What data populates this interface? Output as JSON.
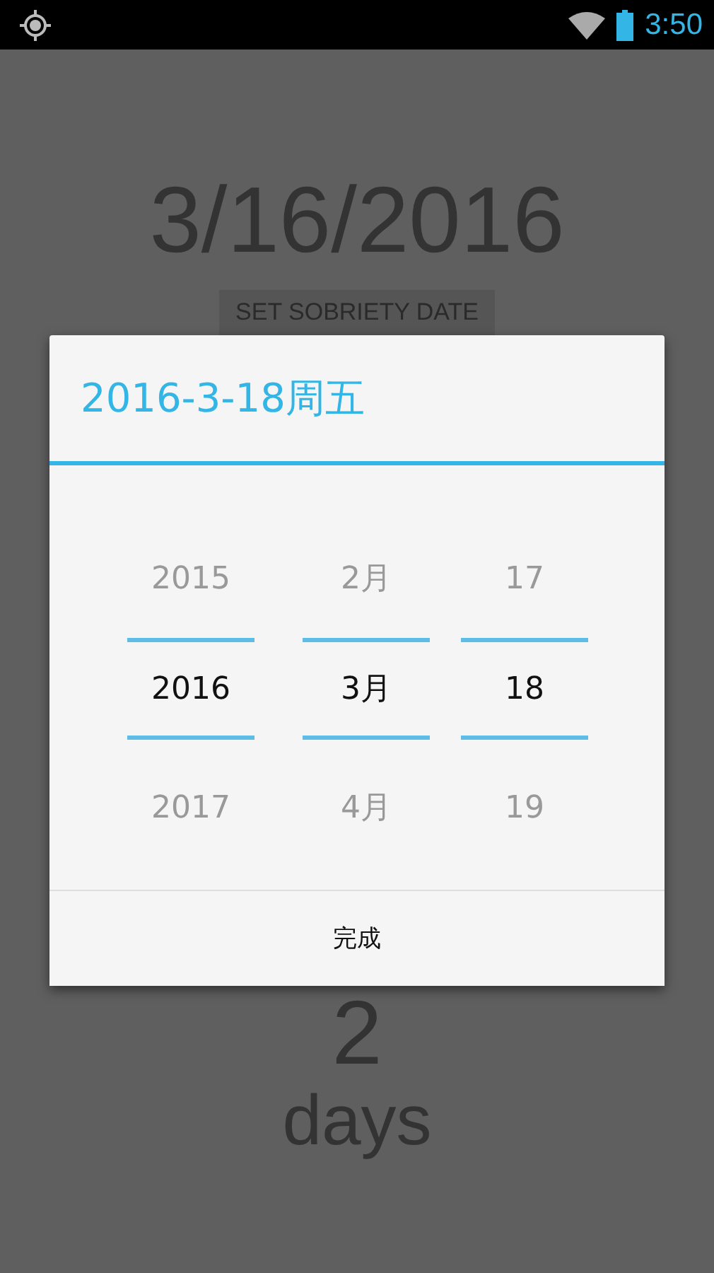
{
  "status_bar": {
    "time": "3:50"
  },
  "background": {
    "date": "3/16/2016",
    "button": "SET SOBRIETY DATE",
    "count": "2",
    "unit": "days"
  },
  "dialog": {
    "title": "2016-3-18周五",
    "columns": [
      {
        "items": [
          {
            "label": "2015",
            "selected": false
          },
          {
            "label": "2016",
            "selected": true
          },
          {
            "label": "2017",
            "selected": false
          }
        ]
      },
      {
        "items": [
          {
            "label": "2月",
            "selected": false
          },
          {
            "label": "3月",
            "selected": true
          },
          {
            "label": "4月",
            "selected": false
          }
        ]
      },
      {
        "items": [
          {
            "label": "17",
            "selected": false
          },
          {
            "label": "18",
            "selected": true
          },
          {
            "label": "19",
            "selected": false
          }
        ]
      }
    ],
    "button": "完成"
  }
}
